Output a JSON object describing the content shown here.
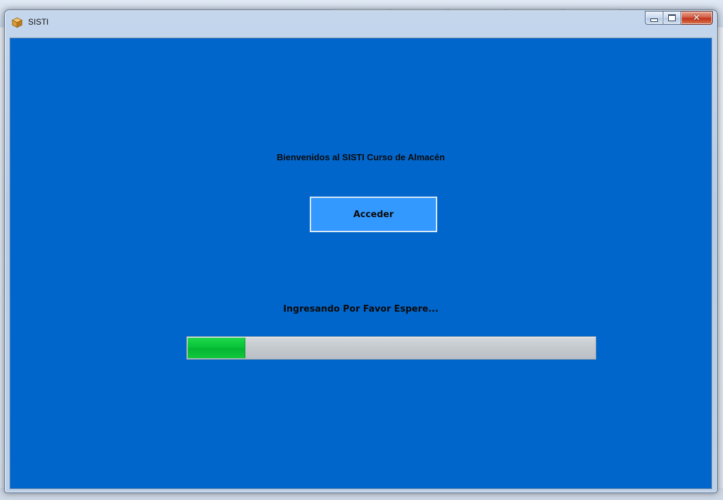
{
  "window": {
    "title": "SISTI"
  },
  "main": {
    "welcome_text": "Bienvenidos al SISTI Curso de Almacén",
    "access_button_label": "Acceder",
    "status_text": "Ingresando Por Favor Espere...",
    "progress": 0.14
  },
  "colors": {
    "client_background": "#0066cc",
    "button_background": "#3399ff",
    "progress_fill": "#08c43a",
    "progress_track": "#c4c9ce"
  },
  "icons": {
    "app": "box-icon",
    "minimize": "minimize-icon",
    "maximize": "maximize-icon",
    "close": "close-icon"
  }
}
